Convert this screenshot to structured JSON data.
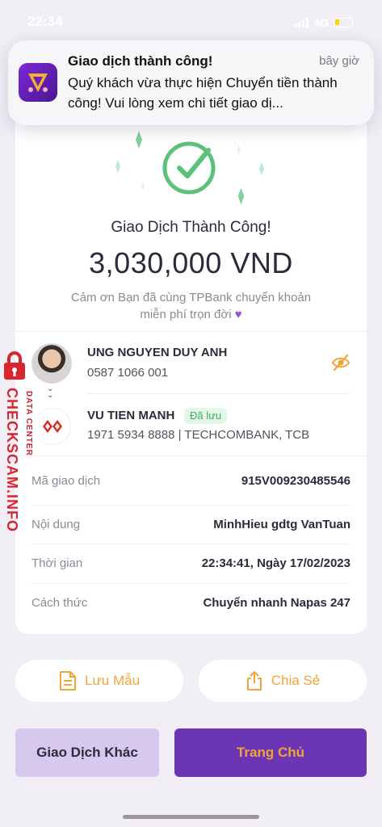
{
  "status_bar": {
    "time": "22:34",
    "network": "4G"
  },
  "notification": {
    "title": "Giao dịch thành công!",
    "time": "bây giờ",
    "body": "Quý khách vừa thực hiện Chuyển tiền thành công! Vui lòng xem chi tiết giao dị..."
  },
  "result": {
    "title": "Giao Dịch Thành Công!",
    "amount": "3,030,000 VND",
    "thanks_line1": "Cảm ơn Bạn đã cùng TPBank chuyển khoản",
    "thanks_line2": "miễn phí trọn đời"
  },
  "sender": {
    "name": "UNG NGUYEN DUY ANH",
    "phone": "0587 1066 001"
  },
  "receiver": {
    "name": "VU TIEN MANH",
    "saved_badge": "Đã lưu",
    "account": "1971 5934 8888 | TECHCOMBANK, TCB"
  },
  "details": [
    {
      "label": "Mã giao dịch",
      "value": "915V009230485546"
    },
    {
      "label": "Nội dung",
      "value": "MinhHieu gdtg VanTuan"
    },
    {
      "label": "Thời gian",
      "value": "22:34:41, Ngày 17/02/2023"
    },
    {
      "label": "Cách thức",
      "value": "Chuyển nhanh Napas 247"
    }
  ],
  "watermark": {
    "main": "CHECKSCAM.INFO",
    "sub": "DATA CENTER"
  },
  "actions": {
    "save_template": "Lưu Mẫu",
    "share": "Chia Sẻ",
    "other_transaction": "Giao Dịch Khác",
    "home": "Trang Chủ"
  },
  "colors": {
    "accent": "#6b35b3",
    "orange": "#f0a43b",
    "success": "#3fae62",
    "watermark": "#d8262e"
  },
  "icons": [
    "signal-icon",
    "battery-icon",
    "app-icon",
    "checkmark-circle-icon",
    "eye-off-icon",
    "bank-logo-icon",
    "document-icon",
    "share-icon",
    "lock-icon"
  ]
}
